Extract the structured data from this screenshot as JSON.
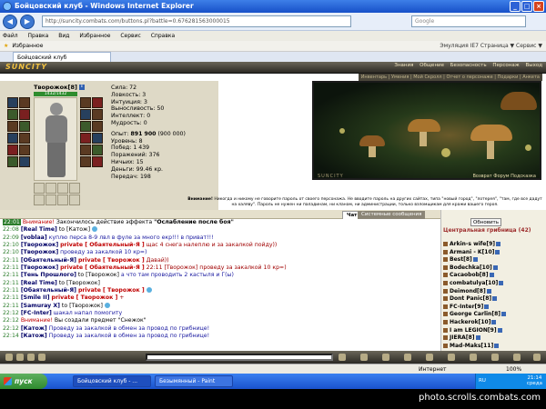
{
  "window": {
    "title": "Бойцовский клуб - Windows Internet Explorer",
    "buttons": [
      "_",
      "□",
      "×"
    ]
  },
  "addressbar": {
    "url": "http://suncity.combats.com/buttons.pl?battle=0.676281563000015",
    "search_placeholder": "Google"
  },
  "menu": [
    "Файл",
    "Правка",
    "Вид",
    "Избранное",
    "Сервис",
    "Справка"
  ],
  "favorites": {
    "label": "Избранное",
    "tools": "Эмуляция IE7   Страница ▼  Сервис ▼"
  },
  "tab": {
    "label": "Бойцовский клуб"
  },
  "game": {
    "logo": "SUNCITY",
    "nav": [
      "Знания",
      "Общение",
      "Безопасность",
      "Персонаж",
      "Выход"
    ],
    "subnav": "Инвентарь | Умения | Мой Скролл | Отчет о персонаже | Подарки | Анкета"
  },
  "character": {
    "name": "Творожок",
    "level": "[8]",
    "hp": "1432/1432",
    "stats": [
      "Сила: 72",
      "Ловкость: 3",
      "Интуиция: 3",
      "Выносливость: 50",
      "Интеллект: 0",
      "Мудрость: 0"
    ],
    "experience_label": "Опыт:",
    "experience": "891 900",
    "experience_next": "(900 000)",
    "info": [
      "Уровень: 8",
      "Побед: 1 439",
      "Поражений: 376",
      "Ничьих: 15"
    ],
    "money": "Деньги: 99.46 кр.",
    "transfers": "Передач: 198"
  },
  "view": {
    "label": "SUNCITY",
    "links": "Возврат  Форум  Подсказка"
  },
  "warning_label": "Внимание!",
  "warning": "Никогда и никому не говорите пароль от своего персонажа. Не вводите пароль на других сайтах, типа \"новый город\", \"лотерея\", \"там, где все дадут на халяву\". Пароль не нужен ни паладинам, ни кланам, ни администрации, только взломщикам для кражи вашего героя.",
  "chat_tabs": [
    "Чат",
    "Системные сообщения"
  ],
  "chat": [
    {
      "time": "22:01",
      "alert": "Внимание!",
      "text": "Закончилось действие эффекта",
      "bold": "\"Ослабление после боя\""
    },
    {
      "time": "22:08",
      "nick": "[Real Time]",
      "to": "to [Катож]",
      "smiley": true
    },
    {
      "time": "22:09",
      "nick": "[voblaa]",
      "msg": "куплю перса 8-9 лвл в фуле за много екр!!! в приват!!!"
    },
    {
      "time": "22:10",
      "nick": "[Творожок]",
      "priv": "private [ Обаятельный-Я ]",
      "msgr": "щас 4 снега налеплю и за закалкой пойду))"
    },
    {
      "time": "22:10",
      "nick": "[Творожок]",
      "msg": "проведу за закалкой 10 кр=)"
    },
    {
      "time": "22:11",
      "nick": "[Обаятельный-Я]",
      "priv": "private [ Творожок ]",
      "msgr": "Давай))"
    },
    {
      "time": "22:11",
      "nick": "[Творожок]",
      "priv": "private [ Обаятельный-Я ]",
      "msgr": "22:11 [Творожок] проведу за закалкой 10 кр=)"
    },
    {
      "time": "22:11",
      "nick": "[Тень Прошлого]",
      "to": "to [Творожок]",
      "msg": "а что там проводить 2 кастыля и Г(ы)"
    },
    {
      "time": "22:11",
      "nick": "[Real Time]",
      "to": "to [Творожок]"
    },
    {
      "time": "22:11",
      "nick": "[Обаятельный-Я]",
      "priv": "private [ Творожок ]",
      "smiley": true
    },
    {
      "time": "22:11",
      "nick": "[Smile II]",
      "priv": "private [ Творожок ]",
      "msgr": "+"
    },
    {
      "time": "22:11",
      "nick": "[Samuray X]",
      "to": "to [Творожок]",
      "smiley": true
    },
    {
      "time": "22:12",
      "nick": "[FC-Inter]",
      "msg": "шакал напал помогиту"
    },
    {
      "time": "22:12",
      "alert": "Внимание!",
      "text": "Вы создали предмет \"Снежок\""
    },
    {
      "time": "22:12",
      "nick": "[Катож]",
      "msg": "Проведу за закалкой в обмен за провод по грибнице!"
    },
    {
      "time": "22:14",
      "nick": "[Катож]",
      "msg": "Проведу за закалкой в обмен за провод по грибнице!"
    }
  ],
  "right": {
    "refresh": "Обновить",
    "location": "Центральная грибница (42)",
    "users": [
      {
        "name": "Arkin-s wife",
        "level": "[9]"
      },
      {
        "name": "Armani - K",
        "level": "[10]"
      },
      {
        "name": "Best",
        "level": "[8]"
      },
      {
        "name": "Bodechka",
        "level": "[10]"
      },
      {
        "name": "Cacaobob",
        "level": "[8]"
      },
      {
        "name": "combatulya",
        "level": "[10]"
      },
      {
        "name": "Deimond",
        "level": "[8]"
      },
      {
        "name": "Dont Panic",
        "level": "[8]"
      },
      {
        "name": "FC-Inter",
        "level": "[9]"
      },
      {
        "name": "George Carlin",
        "level": "[8]"
      },
      {
        "name": "Hackerok",
        "level": "[10]"
      },
      {
        "name": "I am LEGION",
        "level": "[9]"
      },
      {
        "name": "JIERA",
        "level": "[8]"
      },
      {
        "name": "Mad-Maks",
        "level": "[11]"
      }
    ]
  },
  "statusbar": {
    "zone": "Интернет",
    "zoom": "100%"
  },
  "taskbar": {
    "start": "пуск",
    "tasks": [
      "Бойцовский клуб - ...",
      "Безымянный - Paint"
    ],
    "lang": "RU",
    "time": "21:14",
    "day": "среда"
  },
  "watermark": "photo.scrolls.combats.com"
}
